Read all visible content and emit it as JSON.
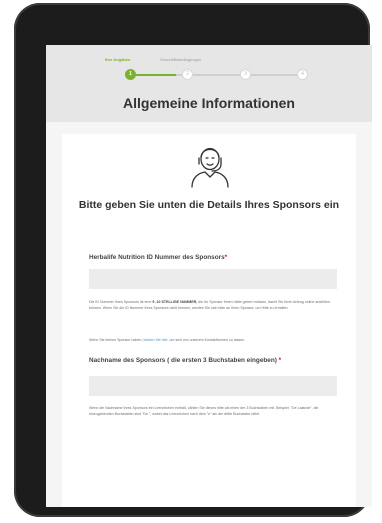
{
  "stepper": {
    "steps": [
      {
        "number": "1",
        "label": "Ihre Angaben",
        "active": true
      },
      {
        "number": "2",
        "label": "Geschäftsbedingungen",
        "active": false
      },
      {
        "number": "3",
        "label": "",
        "active": false
      },
      {
        "number": "4",
        "label": "",
        "active": false
      }
    ],
    "accent_color": "#7bb12e"
  },
  "page": {
    "title": "Allgemeine Informationen",
    "subtitle": "Bitte geben Sie unten die Details Ihres Sponsors ein",
    "avatar_icon": "support-agent-icon"
  },
  "form": {
    "sponsor_id": {
      "label": "Herbalife Nutrition ID Nummer des Sponsors",
      "required_mark": "*",
      "value": "",
      "help_pre": "Die ID Nummer Ihres Sponsors ist eine ",
      "help_bold": "9 -10 STELLIGE NUMMER,",
      "help_post": " die Ihr Sponsor Ihnen hätte geben müssen, damit Sie Ihren Antrag online ausfüllen können. Wenn Sie die ID Nummer Ihres Sponsors nicht kennen, werden Sie sich bitte an Ihren Sponsor, um Hilfe zu erhalten.",
      "help2_pre": "Wenn Sie keinen Sponsor haben, ",
      "help2_link": "klicken Sie hier,",
      "help2_post": " um sich von unserem Kontaktformen zu lassen."
    },
    "sponsor_name": {
      "label": "Nachname des Sponsors ( die ersten 3 Buchstaben eingeben)",
      "required_mark": "*",
      "value": "",
      "help": "Wenn die Nachname Ihres Sponsors ein Leerzeichen enthält, zählen Sie dieses bitte als einen der 3 Buchstaben mit. Beispiel: \"De Lalande\", die einzugebenden Buchstaben sind \"De \", wobei das Leerzeichen nach dem \"e\" als der dritte Buchstabe zählt."
    }
  }
}
